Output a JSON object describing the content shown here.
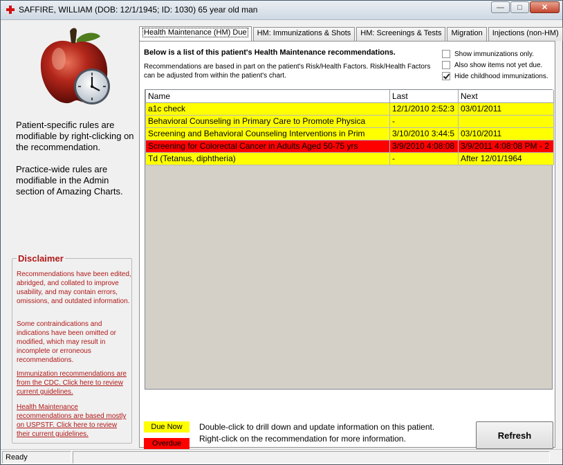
{
  "window": {
    "title": "SAFFIRE, WILLIAM (DOB: 12/1/1945; ID: 1030) 65 year old man",
    "minimize_glyph": "—",
    "maximize_glyph": "□",
    "close_glyph": "✕"
  },
  "left": {
    "logo_icon": "apple-clock-icon",
    "patient_rules": "Patient-specific rules are modifiable by right-clicking on the recommendation.",
    "practice_rules": "Practice-wide rules are modifiable in the Admin section of Amazing Charts.",
    "disclaimer": {
      "title": "Disclaimer",
      "p1": "Recommendations have been edited, abridged, and collated to improve usability, and may contain errors, omissions, and outdated information.",
      "p2": "Some contraindications and indications have been omitted or modified, which may result in incomplete or erroneous recommendations.",
      "link_cdc": "Immunization recommendations are from the CDC. Click here to review current guidelines.",
      "link_uspstf": "Health Maintenance recommendations are based mostly on USPSTF. Click here to review their current guidelines."
    }
  },
  "tabs": [
    {
      "label": "Health Maintenance (HM) Due",
      "active": true
    },
    {
      "label": "HM: Immunizations & Shots"
    },
    {
      "label": "HM: Screenings & Tests"
    },
    {
      "label": "Migration"
    },
    {
      "label": "Injections (non-HM)"
    }
  ],
  "panel": {
    "heading": "Below is a list of this patient's Health Maintenance recommendations.",
    "subtext": "Recommendations are based in part on the patient's Risk/Health Factors. Risk/Health Factors can be adjusted from within the patient's chart.",
    "options": [
      {
        "label": "Show immunizations only.",
        "checked": false
      },
      {
        "label": "Also show items not yet due.",
        "checked": false
      },
      {
        "label": "Hide childhood immunizations.",
        "checked": true
      }
    ]
  },
  "grid": {
    "columns": [
      "Name",
      "Last",
      "Next"
    ],
    "rows": [
      {
        "name": "a1c check",
        "last": "12/1/2010 2:52:3",
        "next": "03/01/2011",
        "status": "due"
      },
      {
        "name": "Behavioral Counseling in Primary Care to Promote Physica",
        "last": "-",
        "next": "",
        "status": "due"
      },
      {
        "name": "Screening and Behavioral Counseling Interventions in Prim",
        "last": "3/10/2010 3:44:5",
        "next": "03/10/2011",
        "status": "due"
      },
      {
        "name": "Screening for Colorectal Cancer in Adults Aged 50-75 yrs",
        "last": "3/9/2010 4:08:08",
        "next": "3/9/2011 4:08:08 PM - 2",
        "status": "overdue"
      },
      {
        "name": "Td (Tetanus, diphtheria)",
        "last": "-",
        "next": "After 12/01/1964",
        "status": "due"
      }
    ]
  },
  "legend": {
    "due_now": "Due Now",
    "overdue": "Overdue",
    "due_color": "#ffff00",
    "overdue_color": "#ff0000",
    "hint1": "Double-click to drill down and update information on this patient.",
    "hint2": "Right-click on the recommendation for more information."
  },
  "refresh_label": "Refresh",
  "status": {
    "text": "Ready"
  }
}
